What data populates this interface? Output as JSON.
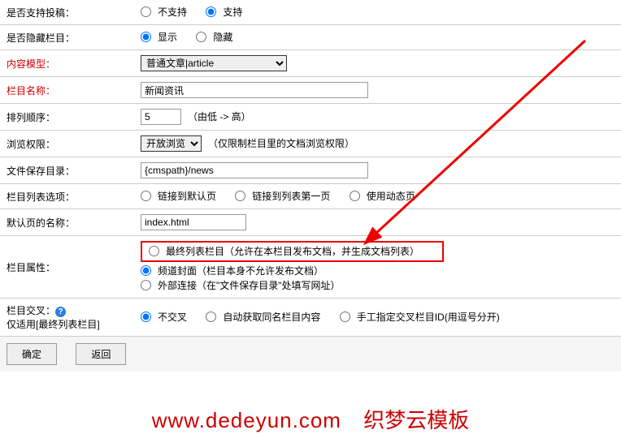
{
  "rows": {
    "submission": {
      "label": "是否支持投稿：",
      "opt1": "不支持",
      "opt2": "支持"
    },
    "hidden": {
      "label": "是否隐藏栏目：",
      "opt1": "显示",
      "opt2": "隐藏"
    },
    "model": {
      "label": "内容模型：",
      "value": "普通文章|article"
    },
    "name": {
      "label": "栏目名称：",
      "value": "新闻资讯"
    },
    "order": {
      "label": "排列顺序：",
      "value": "5",
      "hint": "（由低 -> 高）"
    },
    "browse": {
      "label": "浏览权限：",
      "value": "开放浏览",
      "hint": "（仅限制栏目里的文档浏览权限）"
    },
    "savepath": {
      "label": "文件保存目录：",
      "value": "{cmspath}/news"
    },
    "listopt": {
      "label": "栏目列表选项：",
      "opt1": "链接到默认页",
      "opt2": "链接到列表第一页",
      "opt3": "使用动态页"
    },
    "defaultpage": {
      "label": "默认页的名称：",
      "value": "index.html"
    },
    "attr": {
      "label": "栏目属性：",
      "opt1": "最终列表栏目（允许在本栏目发布文档，并生成文档列表）",
      "opt2": "频道封面（栏目本身不允许发布文档）",
      "opt3": "外部连接（在\"文件保存目录\"处填写网址）"
    },
    "cross": {
      "label": "栏目交叉：",
      "sublabel": "仅适用[最终列表栏目]",
      "opt1": "不交叉",
      "opt2": "自动获取同名栏目内容",
      "opt3": "手工指定交叉栏目ID(用逗号分开)"
    }
  },
  "buttons": {
    "ok": "确定",
    "back": "返回"
  },
  "footer": {
    "url": "www.dedeyun.com",
    "text": "织梦云模板"
  }
}
